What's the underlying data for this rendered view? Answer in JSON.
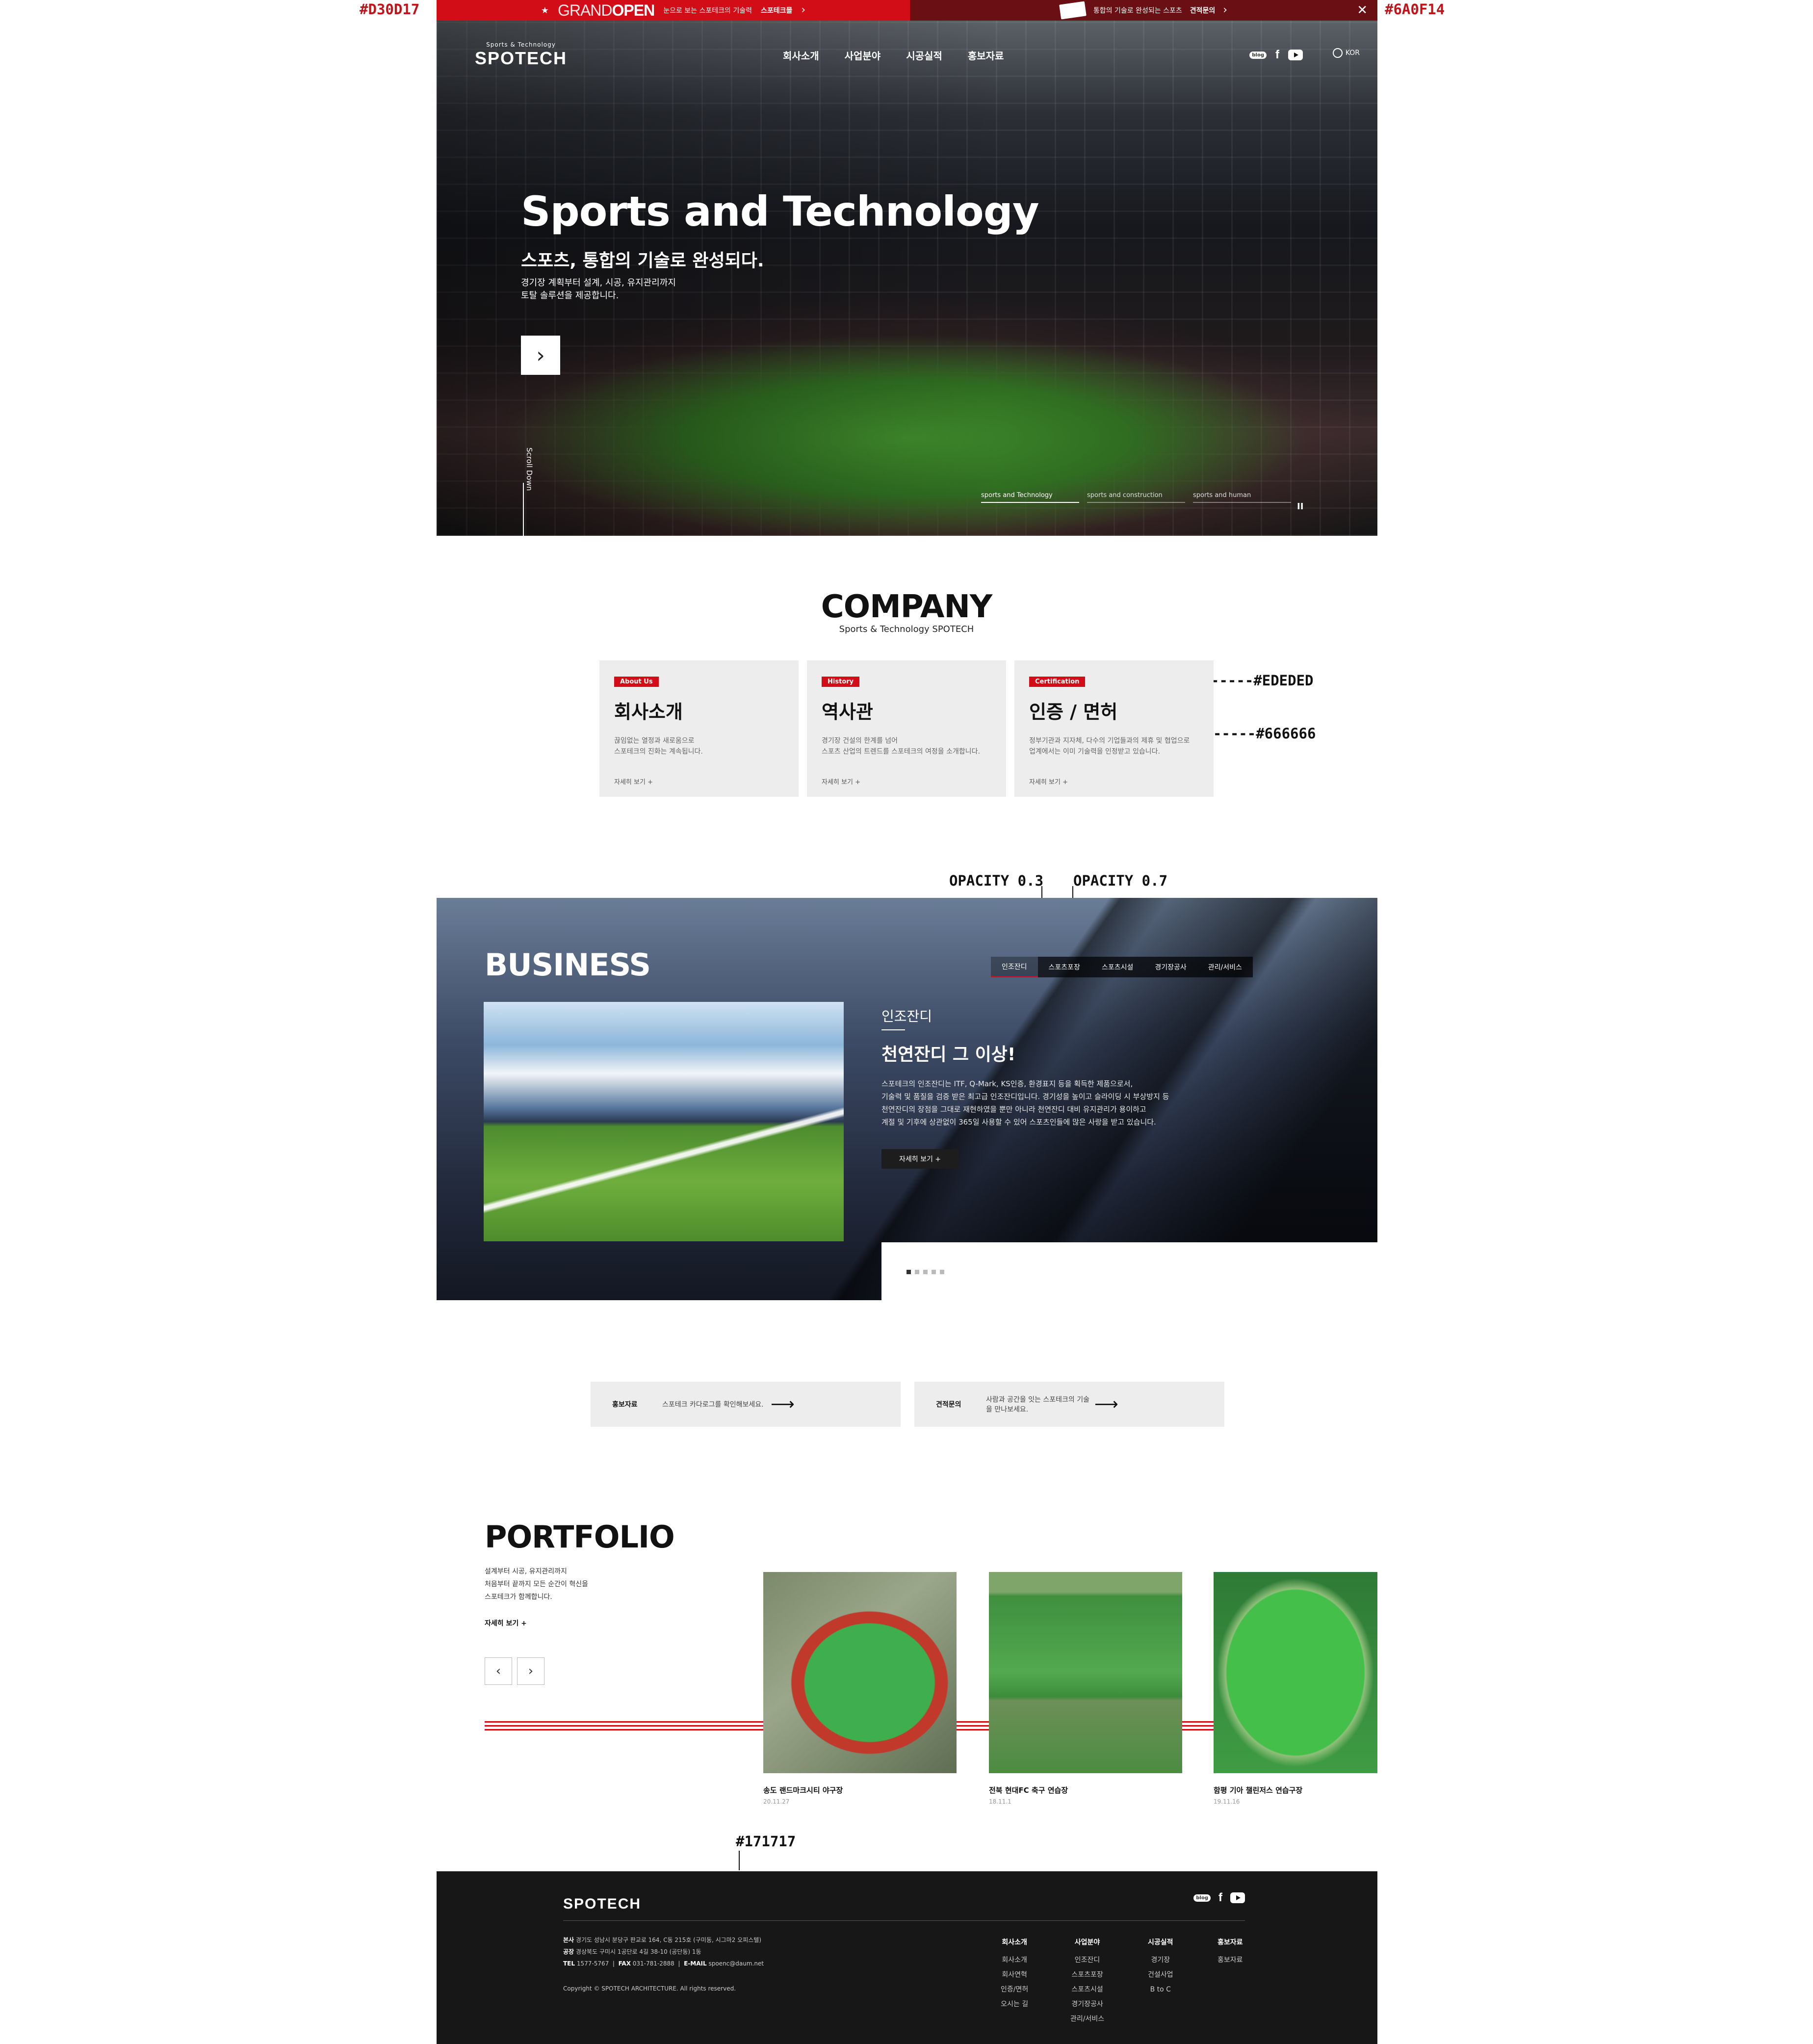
{
  "annotations": {
    "left_color": "#D30D17",
    "right_color": "#6A0F14",
    "card_bg": "-----#EDEDED",
    "card_text": "-------#666666",
    "tab_active": "OPACITY 0.3",
    "tab_inactive": "OPACITY 0.7",
    "footer_color": "#171717"
  },
  "topbar": {
    "grand": "GRAND",
    "open": "OPEN",
    "left_text": "눈으로 보는 스포테크의 기술력",
    "left_link": "스포테크몰",
    "right_text": "통합의 기술로 완성되는 스포츠",
    "right_link": "견적문의",
    "close_icon": "close-icon"
  },
  "nav": {
    "logo_small": "Sports & Technology",
    "logo": "SPOTECH",
    "menu": [
      "회사소개",
      "사업분야",
      "시공실적",
      "홍보자료"
    ],
    "blog": "blog",
    "facebook": "f",
    "lang": "KOR"
  },
  "hero": {
    "title": "Sports and Technology",
    "subtitle": "스포츠, 통합의 기술로 완성되다.",
    "desc_line1": "경기장 계획부터 설계, 시공, 유지관리까지",
    "desc_line2": "토탈 솔루션을 제공합니다.",
    "next_icon": "›",
    "scroll": "Scroll Down",
    "slides": [
      "sports and Technology",
      "sports and construction",
      "sports and human"
    ],
    "pause_icon": "II"
  },
  "company": {
    "title": "COMPANY",
    "subtitle": "Sports & Technology SPOTECH",
    "cards": [
      {
        "badge": "About Us",
        "title": "회사소개",
        "line1": "끊임없는 열정과 새로움으로",
        "line2": "스포테크의 진화는 계속됩니다.",
        "more": "자세히 보기 +"
      },
      {
        "badge": "History",
        "title": "역사관",
        "line1": "경기장 건설의 한계를 넘어",
        "line2": "스포츠 산업의 트렌드를 스포테크의 여정을 소개합니다.",
        "more": "자세히 보기 +"
      },
      {
        "badge": "Certification",
        "title": "인증 / 면허",
        "line1": "정부기관과 지자체, 다수의 기업들과의 제휴 및 협업으로",
        "line2": "업계에서는 이미 기술력을 인정받고 있습니다.",
        "more": "자세히 보기 +"
      }
    ]
  },
  "business": {
    "title": "BUSINESS",
    "tabs": [
      "인조잔디",
      "스포츠포장",
      "스포츠시설",
      "경기장공사",
      "관리/서비스"
    ],
    "category": "인조잔디",
    "headline": "천연잔디 그 이상!",
    "body": [
      "스포테크의 인조잔디는 ITF, Q-Mark, KS인증, 환경표지 등을 획득한 제품으로서,",
      "기술력 및 품질을 검증 받은 최고급 인조잔디입니다. 경기성을 높이고 슬라이딩 시 부상방지 등",
      "천연잔디의 장점을 그대로 재현하였을 뿐만 아니라 천연잔디 대비 유지관리가 용이하고",
      "계절 및 기후에 상관없이 365일 사용할 수 있어 스포츠인들에 많은 사랑을 받고 있습니다."
    ],
    "more": "자세히 보기 +"
  },
  "links": [
    {
      "label": "홍보자료",
      "text": "스포테크 카다로그를 확인해보세요.",
      "arrow": "⟶"
    },
    {
      "label": "견적문의",
      "text": "사람과 공간을 잇는 스포테크의 기술을 만나보세요.",
      "arrow": "⟶"
    }
  ],
  "portfolio": {
    "title": "PORTFOLIO",
    "desc": [
      "설계부터 시공, 유지관리까지",
      "처음부터 끝까지 모든 순간이 혁신을",
      "스포테크가 함께합니다."
    ],
    "more": "자세히 보기 +",
    "prev": "‹",
    "next": "›",
    "items": [
      {
        "name": "송도 랜드마크시티 야구장",
        "date": "20.11.27"
      },
      {
        "name": "전북 현대FC 축구 연습장",
        "date": "18.11.1"
      },
      {
        "name": "함평 기아 챌린저스 연습구장",
        "date": "19.11.16"
      }
    ]
  },
  "footer": {
    "logo": "SPOTECH",
    "addr_label": "본사",
    "addr": "경기도 성남시 분당구 판교로 164, C동 215호 (구미동, 시그마2 오피스텔)",
    "factory_label": "공장",
    "factory": "경상북도 구미시 1공단로 4길 38-10 (공단동) 1동",
    "tel_label": "TEL",
    "tel": "1577-5767",
    "fax_label": "FAX",
    "fax": "031-781-2888",
    "email_label": "E-MAIL",
    "email": "spoenc@daum.net",
    "copyright": "Copyright © SPOTECH ARCHITECTURE. All rights reserved.",
    "columns": [
      {
        "title": "회사소개",
        "items": [
          "회사소개",
          "회사연혁",
          "인증/면허",
          "오시는 길"
        ]
      },
      {
        "title": "사업분야",
        "items": [
          "인조잔디",
          "스포츠포장",
          "스포츠시설",
          "경기장공사",
          "관리/서비스"
        ]
      },
      {
        "title": "시공실적",
        "items": [
          "경기장",
          "건설사업",
          "B to C"
        ]
      },
      {
        "title": "홍보자료",
        "items": [
          "홍보자료"
        ]
      }
    ]
  }
}
